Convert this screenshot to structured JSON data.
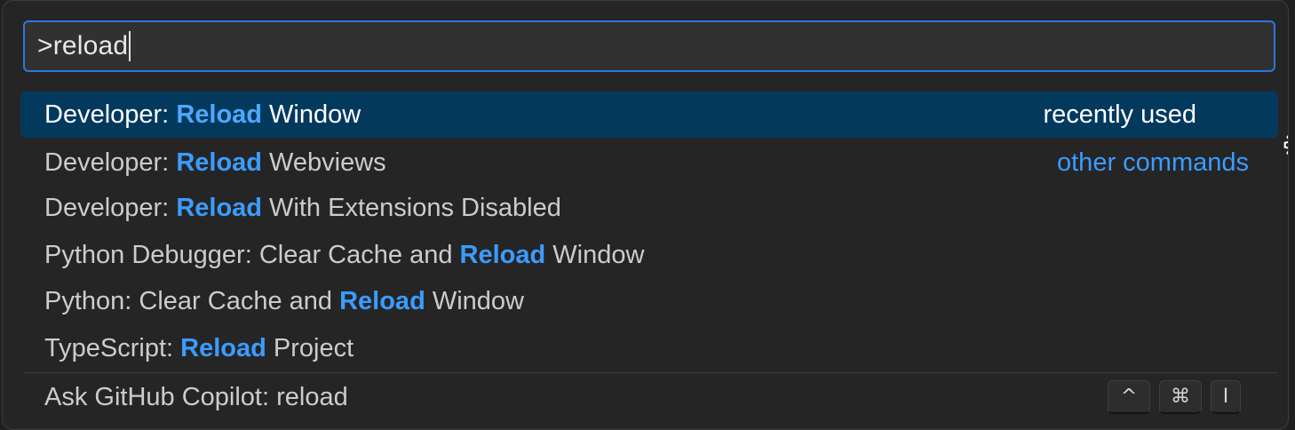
{
  "search": {
    "value": ">reload"
  },
  "results": [
    {
      "prefix": "Developer: ",
      "match": "Reload",
      "suffix": " Window",
      "detail": "recently used",
      "selected": true,
      "icon": "gear-icon"
    },
    {
      "prefix": "Developer: ",
      "match": "Reload",
      "suffix": " Webviews",
      "detail": "other commands",
      "selected": false
    },
    {
      "prefix": "Developer: ",
      "match": "Reload",
      "suffix": " With Extensions Disabled",
      "selected": false
    },
    {
      "prefix": "Python Debugger: Clear Cache and ",
      "match": "Reload",
      "suffix": " Window",
      "selected": false
    },
    {
      "prefix": "Python: Clear Cache and ",
      "match": "Reload",
      "suffix": " Window",
      "selected": false
    },
    {
      "prefix": "TypeScript: ",
      "match": "Reload",
      "suffix": " Project",
      "selected": false
    }
  ],
  "copilot": {
    "label": "Ask GitHub Copilot: reload",
    "keys": [
      "^",
      "⌘",
      "I"
    ]
  },
  "colors": {
    "accent": "#3b9cff",
    "selection_bg": "#04395e",
    "focus_border": "#2b79d6",
    "panel_bg": "#252526"
  }
}
